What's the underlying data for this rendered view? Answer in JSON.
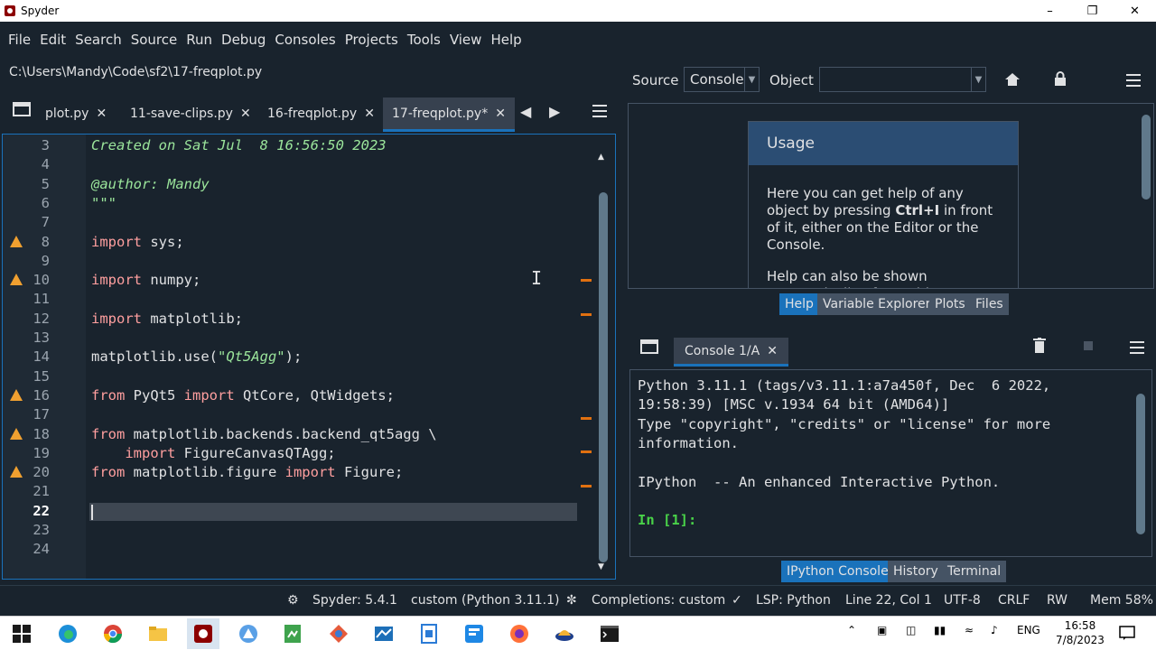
{
  "window": {
    "title": "Spyder"
  },
  "menu": [
    "File",
    "Edit",
    "Search",
    "Source",
    "Run",
    "Debug",
    "Consoles",
    "Projects",
    "Tools",
    "View",
    "Help"
  ],
  "editor": {
    "path": "C:\\Users\\Mandy\\Code\\sf2\\17-freqplot.py",
    "tabs": [
      {
        "label": "plot.py",
        "active": false
      },
      {
        "label": "11-save-clips.py",
        "active": false
      },
      {
        "label": "16-freqplot.py",
        "active": false
      },
      {
        "label": "17-freqplot.py*",
        "active": true
      }
    ],
    "lines": [
      {
        "n": "3",
        "warn": false,
        "text": "Created on Sat Jul  8 16:56:50 2023"
      },
      {
        "n": "4",
        "warn": false,
        "text": ""
      },
      {
        "n": "5",
        "warn": false,
        "text": "@author: Mandy"
      },
      {
        "n": "6",
        "warn": false,
        "text": "\"\"\""
      },
      {
        "n": "7",
        "warn": false,
        "text": ""
      },
      {
        "n": "8",
        "warn": true,
        "text": "import sys;"
      },
      {
        "n": "9",
        "warn": false,
        "text": ""
      },
      {
        "n": "10",
        "warn": true,
        "text": "import numpy;"
      },
      {
        "n": "11",
        "warn": false,
        "text": ""
      },
      {
        "n": "12",
        "warn": false,
        "text": "import matplotlib;"
      },
      {
        "n": "13",
        "warn": false,
        "text": ""
      },
      {
        "n": "14",
        "warn": false,
        "text": "matplotlib.use(\"Qt5Agg\");"
      },
      {
        "n": "15",
        "warn": false,
        "text": ""
      },
      {
        "n": "16",
        "warn": true,
        "text": "from PyQt5 import QtCore, QtWidgets;"
      },
      {
        "n": "17",
        "warn": false,
        "text": ""
      },
      {
        "n": "18",
        "warn": true,
        "text": "from matplotlib.backends.backend_qt5agg \\"
      },
      {
        "n": "19",
        "warn": false,
        "text": "    import FigureCanvasQTAgg;"
      },
      {
        "n": "20",
        "warn": true,
        "text": "from matplotlib.figure import Figure;"
      },
      {
        "n": "21",
        "warn": false,
        "text": ""
      },
      {
        "n": "22",
        "warn": false,
        "text": ""
      },
      {
        "n": "23",
        "warn": false,
        "text": ""
      },
      {
        "n": "24",
        "warn": false,
        "text": ""
      }
    ],
    "current_line": "22"
  },
  "help": {
    "source_label": "Source",
    "source_value": "Console",
    "object_label": "Object",
    "object_value": "",
    "usage_title": "Usage",
    "usage_p1_a": "Here you can get help of any object by pressing ",
    "usage_p1_b": "Ctrl+I",
    "usage_p1_c": " in front of it, either on the Editor or the Console.",
    "usage_p2": "Help can also be shown automatically after writing",
    "tabs": [
      "Help",
      "Variable Explorer",
      "Plots",
      "Files"
    ]
  },
  "console": {
    "tab_label": "Console 1/A",
    "lines": [
      "Python 3.11.1 (tags/v3.11.1:a7a450f, Dec  6 2022,",
      "19:58:39) [MSC v.1934 64 bit (AMD64)]",
      "Type \"copyright\", \"credits\" or \"license\" for more",
      "information.",
      "",
      "IPython  -- An enhanced Interactive Python.",
      ""
    ],
    "prompt": "In [1]:",
    "tabs": [
      "IPython Console",
      "History",
      "Terminal"
    ]
  },
  "status": {
    "spyder": "Spyder: 5.4.1",
    "env": "custom (Python 3.11.1)",
    "completions": "Completions: custom",
    "lsp": "LSP: Python",
    "position": "Line 22, Col 1",
    "encoding": "UTF-8",
    "eol": "CRLF",
    "perm": "RW",
    "mem": "Mem 58%"
  },
  "taskbar": {
    "lang": "ENG",
    "time": "16:58",
    "date": "7/8/2023"
  },
  "colors": {
    "accent": "#1a72bb",
    "background": "#19232d",
    "warning": "#f0a030"
  }
}
